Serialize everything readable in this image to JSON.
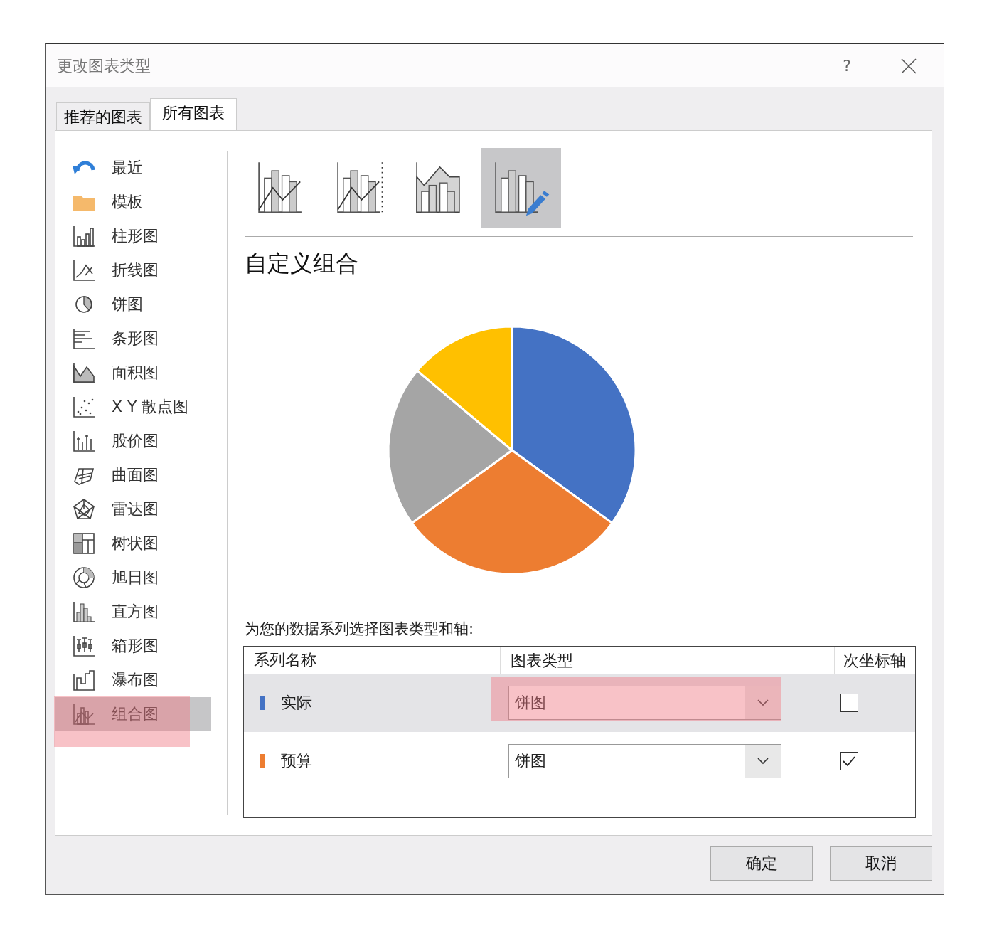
{
  "window": {
    "title": "更改图表类型",
    "help": "?"
  },
  "tabs": [
    {
      "label": "推荐的图表",
      "selected": false
    },
    {
      "label": "所有图表",
      "selected": true
    }
  ],
  "sidebar": {
    "items": [
      {
        "label": "最近",
        "selected": false,
        "highlighted": false
      },
      {
        "label": "模板",
        "selected": false,
        "highlighted": false
      },
      {
        "label": "柱形图",
        "selected": false,
        "highlighted": false
      },
      {
        "label": "折线图",
        "selected": false,
        "highlighted": false
      },
      {
        "label": "饼图",
        "selected": false,
        "highlighted": false
      },
      {
        "label": "条形图",
        "selected": false,
        "highlighted": false
      },
      {
        "label": "面积图",
        "selected": false,
        "highlighted": false
      },
      {
        "label": "X Y 散点图",
        "selected": false,
        "highlighted": false
      },
      {
        "label": "股价图",
        "selected": false,
        "highlighted": false
      },
      {
        "label": "曲面图",
        "selected": false,
        "highlighted": false
      },
      {
        "label": "雷达图",
        "selected": false,
        "highlighted": false
      },
      {
        "label": "树状图",
        "selected": false,
        "highlighted": false
      },
      {
        "label": "旭日图",
        "selected": false,
        "highlighted": false
      },
      {
        "label": "直方图",
        "selected": false,
        "highlighted": false
      },
      {
        "label": "箱形图",
        "selected": false,
        "highlighted": false
      },
      {
        "label": "瀑布图",
        "selected": false,
        "highlighted": false
      },
      {
        "label": "组合图",
        "selected": true,
        "highlighted": true
      }
    ]
  },
  "subtypes": [
    {
      "selected": false
    },
    {
      "selected": false
    },
    {
      "selected": false
    },
    {
      "selected": true
    }
  ],
  "heading": "自定义组合",
  "series_prompt": "为您的数据系列选择图表类型和轴:",
  "table": {
    "columns": [
      "系列名称",
      "图表类型",
      "次坐标轴"
    ],
    "rows": [
      {
        "name": "实际",
        "color": "#4472c4",
        "chart_type": "饼图",
        "secondary_axis": false,
        "selected": true,
        "highlighted": true
      },
      {
        "name": "预算",
        "color": "#ed7d31",
        "chart_type": "饼图",
        "secondary_axis": true,
        "selected": false,
        "highlighted": false
      }
    ]
  },
  "buttons": [
    "确定",
    "取消"
  ]
}
